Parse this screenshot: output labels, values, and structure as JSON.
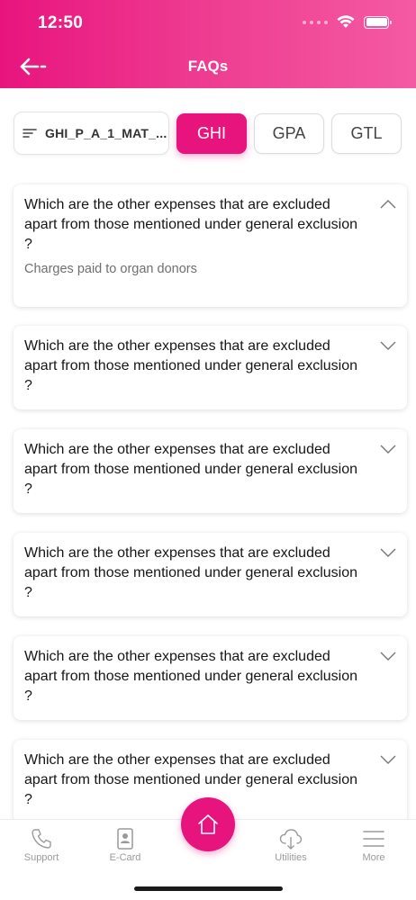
{
  "status_bar": {
    "time": "12:50"
  },
  "header": {
    "title": "FAQs"
  },
  "filter": {
    "plan_label": "GHI_P_A_1_MAT_...",
    "tabs": [
      {
        "label": "GHI",
        "active": true
      },
      {
        "label": "GPA",
        "active": false
      },
      {
        "label": "GTL",
        "active": false
      }
    ]
  },
  "faqs": [
    {
      "question": "Which are the other expenses that are excluded apart from those mentioned under general exclusion ?",
      "answer": "Charges paid to organ donors",
      "expanded": true
    },
    {
      "question": "Which are the other expenses that are excluded apart from those mentioned under general exclusion ?",
      "expanded": false
    },
    {
      "question": "Which are the other expenses that are excluded apart from those mentioned under general exclusion ?",
      "expanded": false
    },
    {
      "question": "Which are the other expenses that are excluded apart from those mentioned under general exclusion ?",
      "expanded": false
    },
    {
      "question": "Which are the other expenses that are excluded apart from those mentioned under general exclusion ?",
      "expanded": false
    },
    {
      "question": "Which are the other expenses that are excluded apart from those mentioned under general exclusion ?",
      "expanded": false
    }
  ],
  "bottom_nav": {
    "items": [
      {
        "label": "Support",
        "icon": "phone-icon"
      },
      {
        "label": "E-Card",
        "icon": "ecard-icon"
      },
      {
        "label": "Utilities",
        "icon": "cloud-download-icon"
      },
      {
        "label": "More",
        "icon": "menu-icon"
      }
    ],
    "home_icon": "home-icon"
  },
  "colors": {
    "brand": "#e8147e",
    "brand_light": "#f45aa3"
  }
}
